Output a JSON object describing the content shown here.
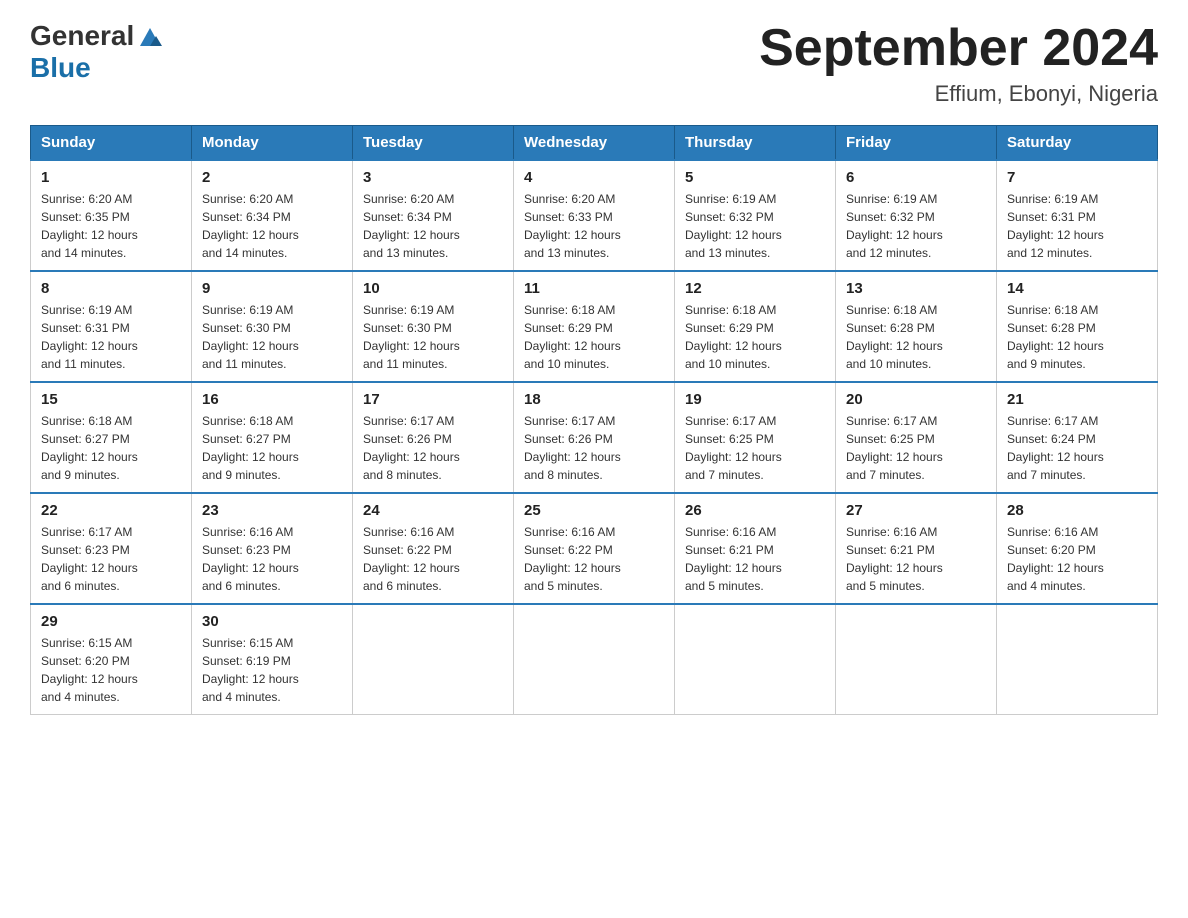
{
  "header": {
    "logo_general": "General",
    "logo_blue": "Blue",
    "title": "September 2024",
    "subtitle": "Effium, Ebonyi, Nigeria"
  },
  "weekdays": [
    "Sunday",
    "Monday",
    "Tuesday",
    "Wednesday",
    "Thursday",
    "Friday",
    "Saturday"
  ],
  "weeks": [
    [
      {
        "day": "1",
        "sunrise": "6:20 AM",
        "sunset": "6:35 PM",
        "daylight": "12 hours and 14 minutes."
      },
      {
        "day": "2",
        "sunrise": "6:20 AM",
        "sunset": "6:34 PM",
        "daylight": "12 hours and 14 minutes."
      },
      {
        "day": "3",
        "sunrise": "6:20 AM",
        "sunset": "6:34 PM",
        "daylight": "12 hours and 13 minutes."
      },
      {
        "day": "4",
        "sunrise": "6:20 AM",
        "sunset": "6:33 PM",
        "daylight": "12 hours and 13 minutes."
      },
      {
        "day": "5",
        "sunrise": "6:19 AM",
        "sunset": "6:32 PM",
        "daylight": "12 hours and 13 minutes."
      },
      {
        "day": "6",
        "sunrise": "6:19 AM",
        "sunset": "6:32 PM",
        "daylight": "12 hours and 12 minutes."
      },
      {
        "day": "7",
        "sunrise": "6:19 AM",
        "sunset": "6:31 PM",
        "daylight": "12 hours and 12 minutes."
      }
    ],
    [
      {
        "day": "8",
        "sunrise": "6:19 AM",
        "sunset": "6:31 PM",
        "daylight": "12 hours and 11 minutes."
      },
      {
        "day": "9",
        "sunrise": "6:19 AM",
        "sunset": "6:30 PM",
        "daylight": "12 hours and 11 minutes."
      },
      {
        "day": "10",
        "sunrise": "6:19 AM",
        "sunset": "6:30 PM",
        "daylight": "12 hours and 11 minutes."
      },
      {
        "day": "11",
        "sunrise": "6:18 AM",
        "sunset": "6:29 PM",
        "daylight": "12 hours and 10 minutes."
      },
      {
        "day": "12",
        "sunrise": "6:18 AM",
        "sunset": "6:29 PM",
        "daylight": "12 hours and 10 minutes."
      },
      {
        "day": "13",
        "sunrise": "6:18 AM",
        "sunset": "6:28 PM",
        "daylight": "12 hours and 10 minutes."
      },
      {
        "day": "14",
        "sunrise": "6:18 AM",
        "sunset": "6:28 PM",
        "daylight": "12 hours and 9 minutes."
      }
    ],
    [
      {
        "day": "15",
        "sunrise": "6:18 AM",
        "sunset": "6:27 PM",
        "daylight": "12 hours and 9 minutes."
      },
      {
        "day": "16",
        "sunrise": "6:18 AM",
        "sunset": "6:27 PM",
        "daylight": "12 hours and 9 minutes."
      },
      {
        "day": "17",
        "sunrise": "6:17 AM",
        "sunset": "6:26 PM",
        "daylight": "12 hours and 8 minutes."
      },
      {
        "day": "18",
        "sunrise": "6:17 AM",
        "sunset": "6:26 PM",
        "daylight": "12 hours and 8 minutes."
      },
      {
        "day": "19",
        "sunrise": "6:17 AM",
        "sunset": "6:25 PM",
        "daylight": "12 hours and 7 minutes."
      },
      {
        "day": "20",
        "sunrise": "6:17 AM",
        "sunset": "6:25 PM",
        "daylight": "12 hours and 7 minutes."
      },
      {
        "day": "21",
        "sunrise": "6:17 AM",
        "sunset": "6:24 PM",
        "daylight": "12 hours and 7 minutes."
      }
    ],
    [
      {
        "day": "22",
        "sunrise": "6:17 AM",
        "sunset": "6:23 PM",
        "daylight": "12 hours and 6 minutes."
      },
      {
        "day": "23",
        "sunrise": "6:16 AM",
        "sunset": "6:23 PM",
        "daylight": "12 hours and 6 minutes."
      },
      {
        "day": "24",
        "sunrise": "6:16 AM",
        "sunset": "6:22 PM",
        "daylight": "12 hours and 6 minutes."
      },
      {
        "day": "25",
        "sunrise": "6:16 AM",
        "sunset": "6:22 PM",
        "daylight": "12 hours and 5 minutes."
      },
      {
        "day": "26",
        "sunrise": "6:16 AM",
        "sunset": "6:21 PM",
        "daylight": "12 hours and 5 minutes."
      },
      {
        "day": "27",
        "sunrise": "6:16 AM",
        "sunset": "6:21 PM",
        "daylight": "12 hours and 5 minutes."
      },
      {
        "day": "28",
        "sunrise": "6:16 AM",
        "sunset": "6:20 PM",
        "daylight": "12 hours and 4 minutes."
      }
    ],
    [
      {
        "day": "29",
        "sunrise": "6:15 AM",
        "sunset": "6:20 PM",
        "daylight": "12 hours and 4 minutes."
      },
      {
        "day": "30",
        "sunrise": "6:15 AM",
        "sunset": "6:19 PM",
        "daylight": "12 hours and 4 minutes."
      },
      null,
      null,
      null,
      null,
      null
    ]
  ],
  "labels": {
    "sunrise": "Sunrise:",
    "sunset": "Sunset:",
    "daylight": "Daylight:"
  }
}
